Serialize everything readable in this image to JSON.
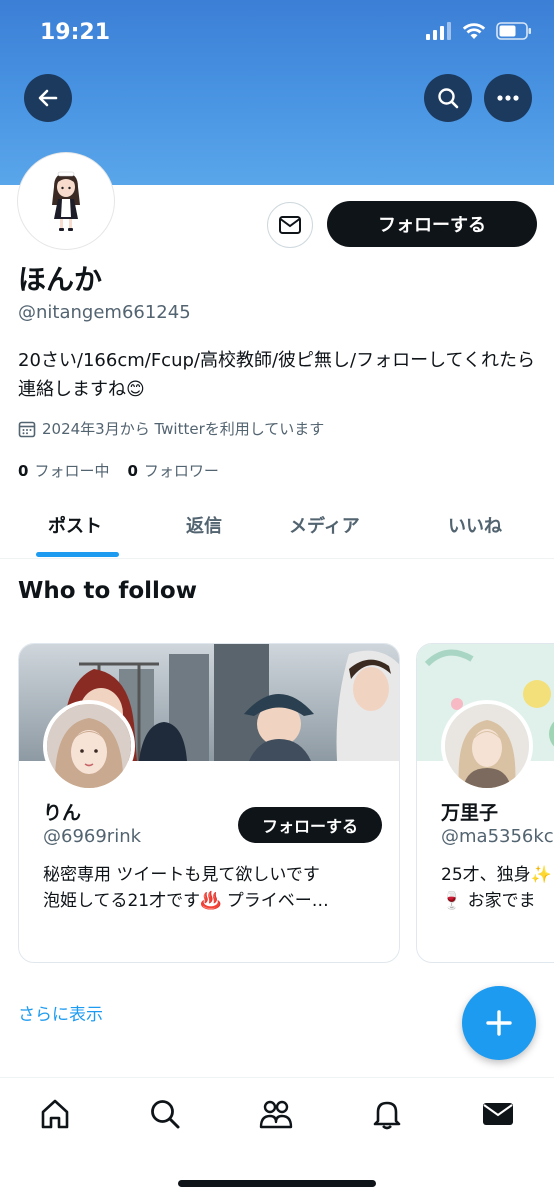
{
  "status_bar": {
    "time": "19:21"
  },
  "profile": {
    "name": "ほんか",
    "handle": "@nitangem661245",
    "bio": "20さい/166cm/Fcup/高校教師/彼ピ無し/フォローしてくれたら連絡しますね😊",
    "joined": "2024年3月から Twitterを利用しています",
    "following_count": "0",
    "following_label": "フォロー中",
    "followers_count": "0",
    "followers_label": "フォロワー",
    "follow_label": "フォローする"
  },
  "tabs": [
    {
      "label": "ポスト"
    },
    {
      "label": "返信"
    },
    {
      "label": "メディア"
    },
    {
      "label": "いいね"
    }
  ],
  "who_to_follow": {
    "title": "Who to follow",
    "cards": [
      {
        "name": "りん",
        "handle": "@6969rink",
        "bio_line1": "秘密専用 ツイートも見て欲しいです",
        "bio_line2": "泡姫してる21才です♨️ プライベー…",
        "follow_label": "フォローする"
      },
      {
        "name": "万里子",
        "handle": "@ma5356kc",
        "bio_line1": "25才、独身✨",
        "bio_line2": "🍷 お家でま"
      }
    ],
    "more_label": "さらに表示"
  },
  "colors": {
    "accent": "#1d9bf0",
    "header": "#4a95e3",
    "text": "#0f1419",
    "muted": "#536471"
  },
  "icons": [
    "back-arrow-icon",
    "search-icon",
    "more-icon",
    "mail-icon",
    "calendar-icon",
    "plus-icon",
    "home-icon",
    "explore-icon",
    "communities-icon",
    "notifications-icon",
    "messages-icon"
  ]
}
